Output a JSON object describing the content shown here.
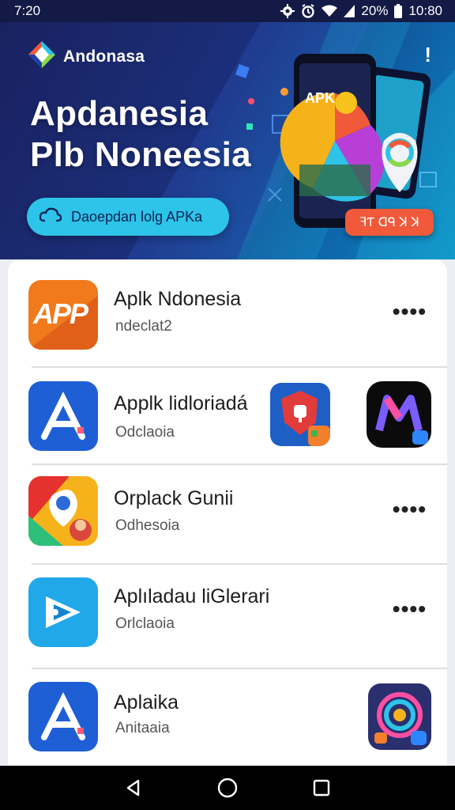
{
  "status_bar": {
    "time": "7:20",
    "battery_text": "20%",
    "clock_text": "10:80",
    "icons": [
      "settings-icon",
      "alarm-icon",
      "wifi-icon",
      "signal-icon",
      "battery-icon"
    ]
  },
  "hero": {
    "brand": "Andonasa",
    "exclamation": "!",
    "title_line1": "Apdanesia",
    "title_line2": "Plb Noneesia",
    "cta_label": "Daoepdan lolg APKa",
    "phone_label": "APK",
    "badge_label": "ꟻƬ ᗡᑫ ꓘ ꓘ"
  },
  "apps": [
    {
      "name": "Aplk Ndonesia",
      "subtitle": "ndeclat2",
      "icon": "app-orange-icon",
      "icon_text": "APP",
      "has_more": true
    },
    {
      "name": "Applk lidloriadá",
      "subtitle": "Odclaoia",
      "icon": "app-store-a-icon",
      "has_more": false
    },
    {
      "name": "Orplack Gunii",
      "subtitle": "Odhesoia",
      "icon": "map-pin-app-icon",
      "has_more": true
    },
    {
      "name": "Aplıladau liGlerari",
      "subtitle": "Orlclaoia",
      "icon": "play-arrow-app-icon",
      "has_more": true
    },
    {
      "name": "Aplaika",
      "subtitle": "Anitaaia",
      "icon": "app-store-a-icon",
      "has_more": false
    }
  ],
  "more_label": "••••",
  "nav": [
    "back-icon",
    "home-icon",
    "recents-icon"
  ],
  "colors": {
    "hero_start": "#1a2160",
    "hero_end": "#0b8cc2",
    "cta": "#2ec3e8",
    "badge": "#f0593a",
    "orange_app": "#f07a1c",
    "blue_app": "#1f5fd6"
  }
}
